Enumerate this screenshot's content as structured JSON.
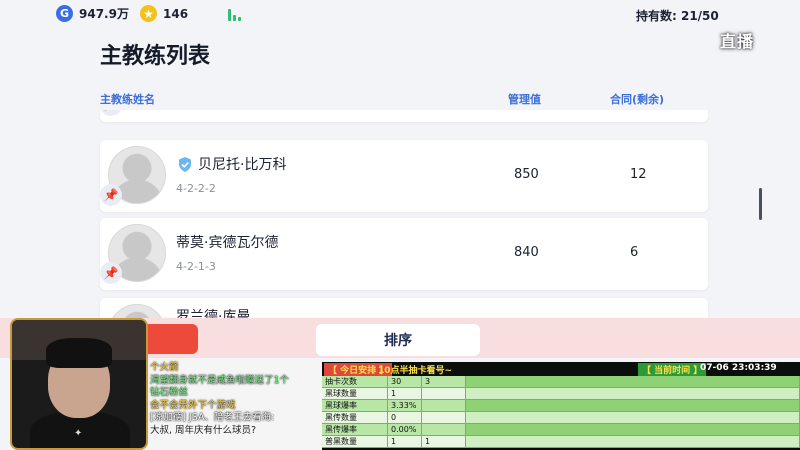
{
  "topbar": {
    "gold_icon_letter": "G",
    "gold_amount": "947.9万",
    "star_icon": "★",
    "star_amount": "146",
    "holdings_label": "持有数: 21/50",
    "live_watermark": "直播"
  },
  "page": {
    "title": "主教练列表"
  },
  "columns": {
    "name": "主教练姓名",
    "management": "管理值",
    "contract": "合同(剩余)"
  },
  "coaches": [
    {
      "name": "贝尼托·比万科",
      "formation": "4-2-2-2",
      "management": "850",
      "contract": "12",
      "verified": true
    },
    {
      "name": "蒂莫·宾德瓦尔德",
      "formation": "4-2-1-3",
      "management": "840",
      "contract": "6",
      "verified": false
    },
    {
      "name": "罗兰德·库曼",
      "formation": "",
      "management": "",
      "contract": "",
      "verified": false
    }
  ],
  "buttons": {
    "sort": "排序"
  },
  "stream": {
    "chat": [
      {
        "text": "个火箭",
        "style": "c-yellow"
      },
      {
        "text": "渴望翻身就不是咸鱼啦赠送了1个",
        "style": "c-green"
      },
      {
        "text": "钻石粉丝",
        "style": "c-green"
      },
      {
        "text": "会不会另外下个游戏",
        "style": "c-yellow"
      },
      {
        "text": "[凉加德] JSA、陪老王去看海:",
        "style": "c-white"
      },
      {
        "text": "大叔, 周年庆有什么球员?",
        "style": "c-dark"
      }
    ],
    "panel": {
      "tag_left": "【 今日安排 】",
      "title": "10点半抽卡看号~",
      "tag_right": "【 当前时间 】",
      "time": "07-06 23:03:39",
      "rows": [
        {
          "label": "抽卡次数",
          "value": "30",
          "extra": "3"
        },
        {
          "label": "黑球数量",
          "value": "1",
          "extra": ""
        },
        {
          "label": "黑球爆率",
          "value": "3.33%",
          "extra": ""
        },
        {
          "label": "黑传数量",
          "value": "0",
          "extra": ""
        },
        {
          "label": "黑传爆率",
          "value": "0.00%",
          "extra": ""
        },
        {
          "label": "普黑数量",
          "value": "1",
          "extra": "1"
        }
      ]
    }
  },
  "colors": {
    "accent_blue": "#3d6fd8",
    "sort_text": "#1f2a55",
    "red_button": "#ee4a3b"
  }
}
